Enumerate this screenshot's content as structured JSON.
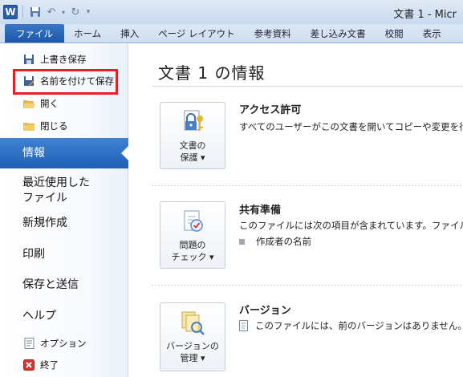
{
  "window": {
    "title": "文書 1 - Micr",
    "app_icon_letter": "W"
  },
  "ribbon_tabs": [
    {
      "label": "ファイル"
    },
    {
      "label": "ホーム"
    },
    {
      "label": "挿入"
    },
    {
      "label": "ページ レイアウト"
    },
    {
      "label": "参考資料"
    },
    {
      "label": "差し込み文書"
    },
    {
      "label": "校閲"
    },
    {
      "label": "表示"
    }
  ],
  "backstage": {
    "commands": [
      {
        "label": "上書き保存",
        "icon": "save-icon"
      },
      {
        "label": "名前を付けて保存",
        "icon": "save-as-icon"
      },
      {
        "label": "開く",
        "icon": "open-folder-icon"
      },
      {
        "label": "閉じる",
        "icon": "close-folder-icon"
      }
    ],
    "nav": [
      {
        "label": "情報",
        "selected": true
      },
      {
        "label": "最近使用した\nファイル"
      },
      {
        "label": "新規作成"
      },
      {
        "label": "印刷"
      },
      {
        "label": "保存と送信"
      },
      {
        "label": "ヘルプ"
      }
    ],
    "bottom_commands": [
      {
        "label": "オプション",
        "icon": "options-icon"
      },
      {
        "label": "終了",
        "icon": "exit-icon"
      }
    ]
  },
  "info": {
    "title": "文書 1 の情報",
    "sections": [
      {
        "button_line1": "文書の",
        "button_line2": "保護 ▾",
        "heading": "アクセス許可",
        "description": "すべてのユーザーがこの文書を開いてコピーや変更を行"
      },
      {
        "button_line1": "問題の",
        "button_line2": "チェック ▾",
        "heading": "共有準備",
        "description": "このファイルには次の項目が含まれています。ファイルの共",
        "bullet": "作成者の名前"
      },
      {
        "button_line1": "バージョンの",
        "button_line2": "管理 ▾",
        "heading": "バージョン",
        "description": "このファイルには、前のバージョンはありません。"
      }
    ]
  },
  "colors": {
    "accent": "#1f5fb5",
    "highlight_box": "#ee1c24"
  }
}
